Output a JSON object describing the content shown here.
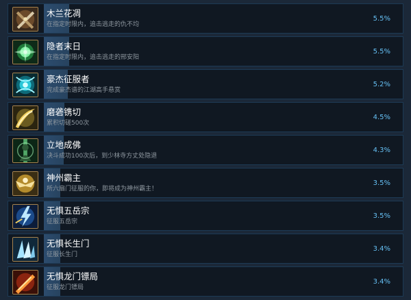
{
  "achievements": [
    {
      "title": "木兰花凋",
      "desc": "在指定时限内，追击逃走的仇不均",
      "percent": "5.5%",
      "progress": 0.055,
      "icon": "crossed-weapons-icon"
    },
    {
      "title": "隐者末日",
      "desc": "在指定时限内，追击逃走的邢安阳",
      "percent": "5.5%",
      "progress": 0.055,
      "icon": "green-burst-icon"
    },
    {
      "title": "豪杰征服者",
      "desc": "完成豪杰谱的江湖高手悬赏",
      "percent": "5.2%",
      "progress": 0.052,
      "icon": "cyan-orb-icon"
    },
    {
      "title": "磨砻镌切",
      "desc": "累积切磋500次",
      "percent": "4.5%",
      "progress": 0.045,
      "icon": "golden-slash-icon"
    },
    {
      "title": "立地成佛",
      "desc": "决斗成功100次后，到少林寺方丈处隐退",
      "percent": "4.3%",
      "progress": 0.043,
      "icon": "green-monk-icon"
    },
    {
      "title": "神州霸主",
      "desc": "所六扇门征服的你，即将成为神州霸主！",
      "percent": "3.5%",
      "progress": 0.035,
      "icon": "golden-eagle-icon"
    },
    {
      "title": "无惧五岳宗",
      "desc": "征服五岳宗",
      "percent": "3.5%",
      "progress": 0.035,
      "icon": "blue-lightning-icon"
    },
    {
      "title": "无惧长生门",
      "desc": "征服长生门",
      "percent": "3.4%",
      "progress": 0.034,
      "icon": "ice-shards-icon"
    },
    {
      "title": "无惧龙门镖局",
      "desc": "征服龙门镖局",
      "percent": "3.4%",
      "progress": 0.034,
      "icon": "fire-strike-icon"
    }
  ]
}
